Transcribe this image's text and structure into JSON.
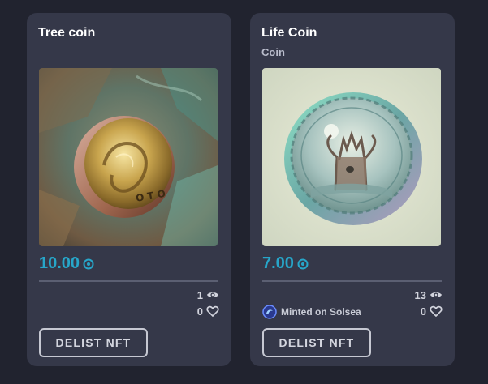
{
  "colors": {
    "background": "#21232f",
    "card": "#353849",
    "price": "#27a6c9",
    "divider": "#5b5f72"
  },
  "cards": [
    {
      "title": "Tree coin",
      "price": "10.00",
      "currency_icon": "solana-icon",
      "views": "1",
      "likes": "0",
      "button_label": "DELIST NFT",
      "image": "golden-coin-artwork"
    },
    {
      "title": "Life Coin",
      "subtitle": "Coin",
      "price": "7.00",
      "currency_icon": "solana-icon",
      "views": "13",
      "likes": "0",
      "minted_label": "Minted on Solsea",
      "minted_icon": "solsea-logo",
      "button_label": "DELIST NFT",
      "image": "silver-coin-artwork"
    }
  ]
}
